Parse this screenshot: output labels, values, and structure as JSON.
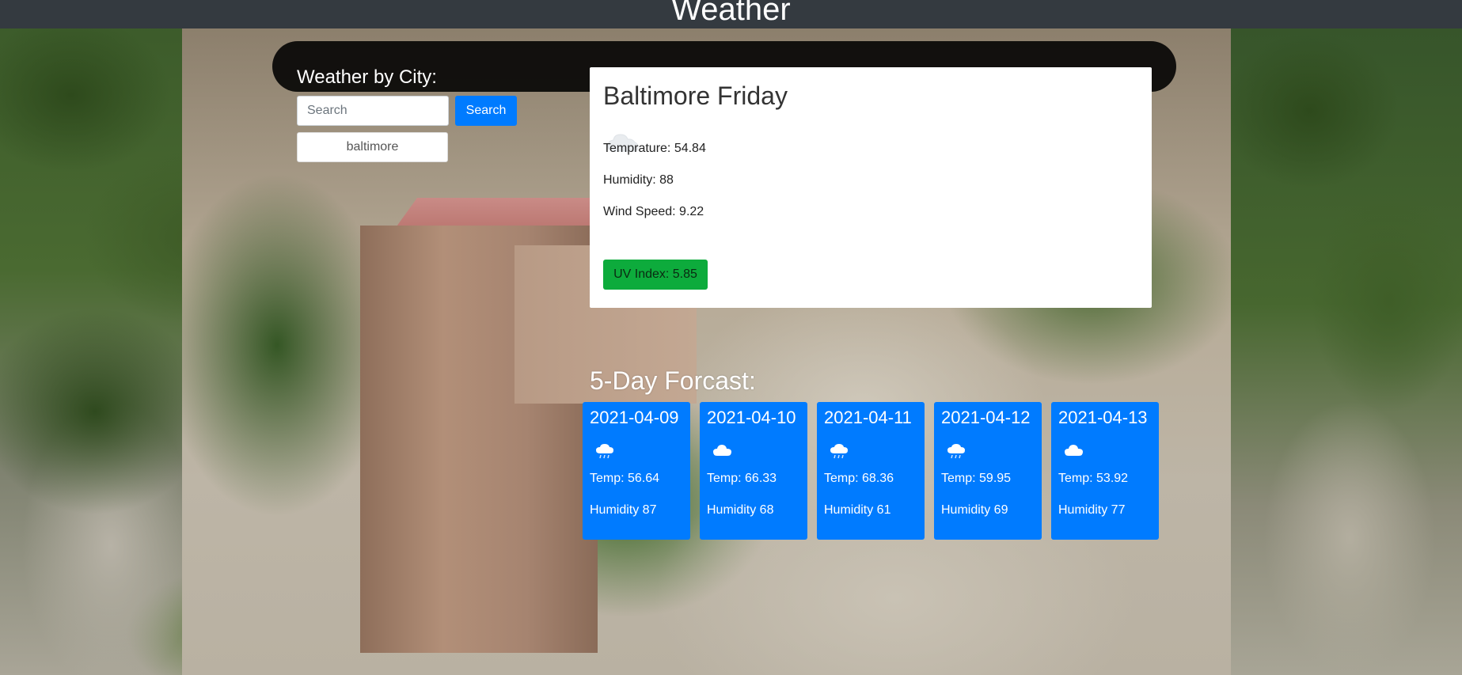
{
  "header": {
    "title": "Weather"
  },
  "search": {
    "heading": "Weather by City:",
    "placeholder": "Search",
    "button_label": "Search",
    "history": [
      "baltimore"
    ]
  },
  "current": {
    "title": "Baltimore Friday",
    "icon": "cloud-icon",
    "temperature": "Temprature: 54.84",
    "humidity": "Humidity: 88",
    "wind": "Wind Speed: 9.22",
    "uv": "UV Index: 5.85",
    "uv_color": "#0dab3c"
  },
  "forecast": {
    "heading": "5-Day Forcast:",
    "card_color": "#007bff",
    "days": [
      {
        "date": "2021-04-09",
        "icon": "rain-cloud-icon",
        "temp": "Temp: 56.64",
        "humidity": "Humidity 87"
      },
      {
        "date": "2021-04-10",
        "icon": "cloud-icon",
        "temp": "Temp: 66.33",
        "humidity": "Humidity 68"
      },
      {
        "date": "2021-04-11",
        "icon": "rain-cloud-icon",
        "temp": "Temp: 68.36",
        "humidity": "Humidity 61"
      },
      {
        "date": "2021-04-12",
        "icon": "rain-cloud-icon",
        "temp": "Temp: 59.95",
        "humidity": "Humidity 69"
      },
      {
        "date": "2021-04-13",
        "icon": "cloud-icon",
        "temp": "Temp: 53.92",
        "humidity": "Humidity 77"
      }
    ]
  }
}
